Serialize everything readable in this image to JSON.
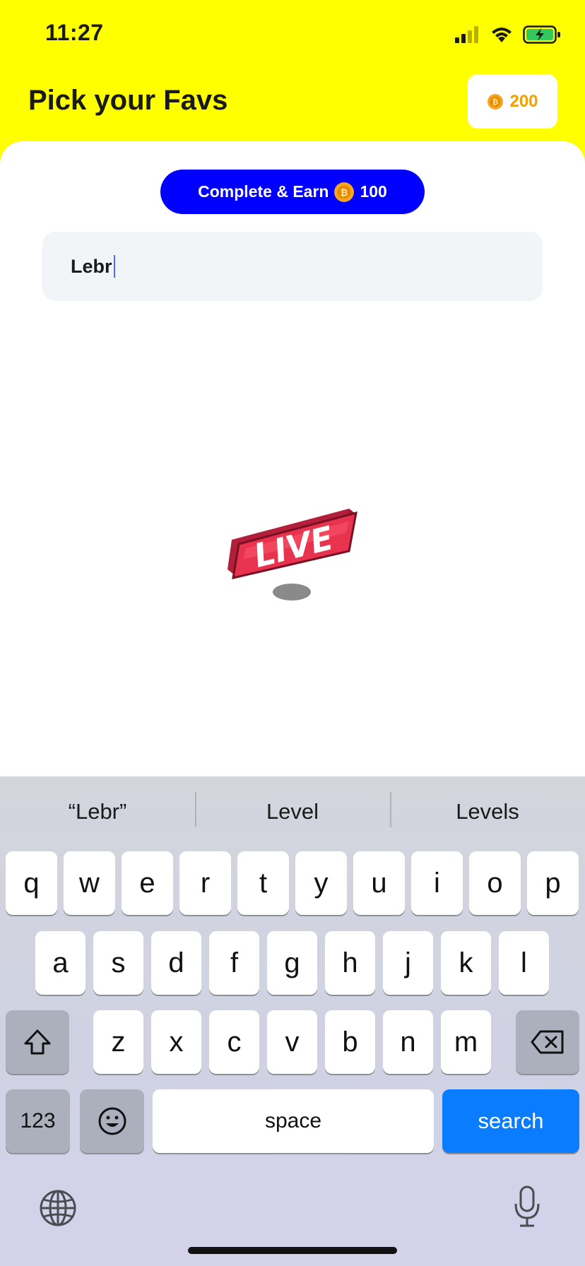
{
  "status_bar": {
    "time": "11:27"
  },
  "header": {
    "title": "Pick your Favs",
    "coin_balance": "200"
  },
  "earn_button": {
    "prefix": "Complete & Earn",
    "amount": "100"
  },
  "search": {
    "value": "Lebr"
  },
  "live_badge": {
    "text": "LIVE"
  },
  "keyboard": {
    "suggestions": [
      "“Lebr”",
      "Level",
      "Levels"
    ],
    "row1": [
      "q",
      "w",
      "e",
      "r",
      "t",
      "y",
      "u",
      "i",
      "o",
      "p"
    ],
    "row2": [
      "a",
      "s",
      "d",
      "f",
      "g",
      "h",
      "j",
      "k",
      "l"
    ],
    "row3": [
      "z",
      "x",
      "c",
      "v",
      "b",
      "n",
      "m"
    ],
    "numbers_label": "123",
    "space_label": "space",
    "search_label": "search"
  },
  "colors": {
    "header_bg": "#ffff00",
    "earn_button": "#0000ff",
    "coin": "#f0a000",
    "search_key": "#0a7cff",
    "live_badge": "#e8334f"
  }
}
